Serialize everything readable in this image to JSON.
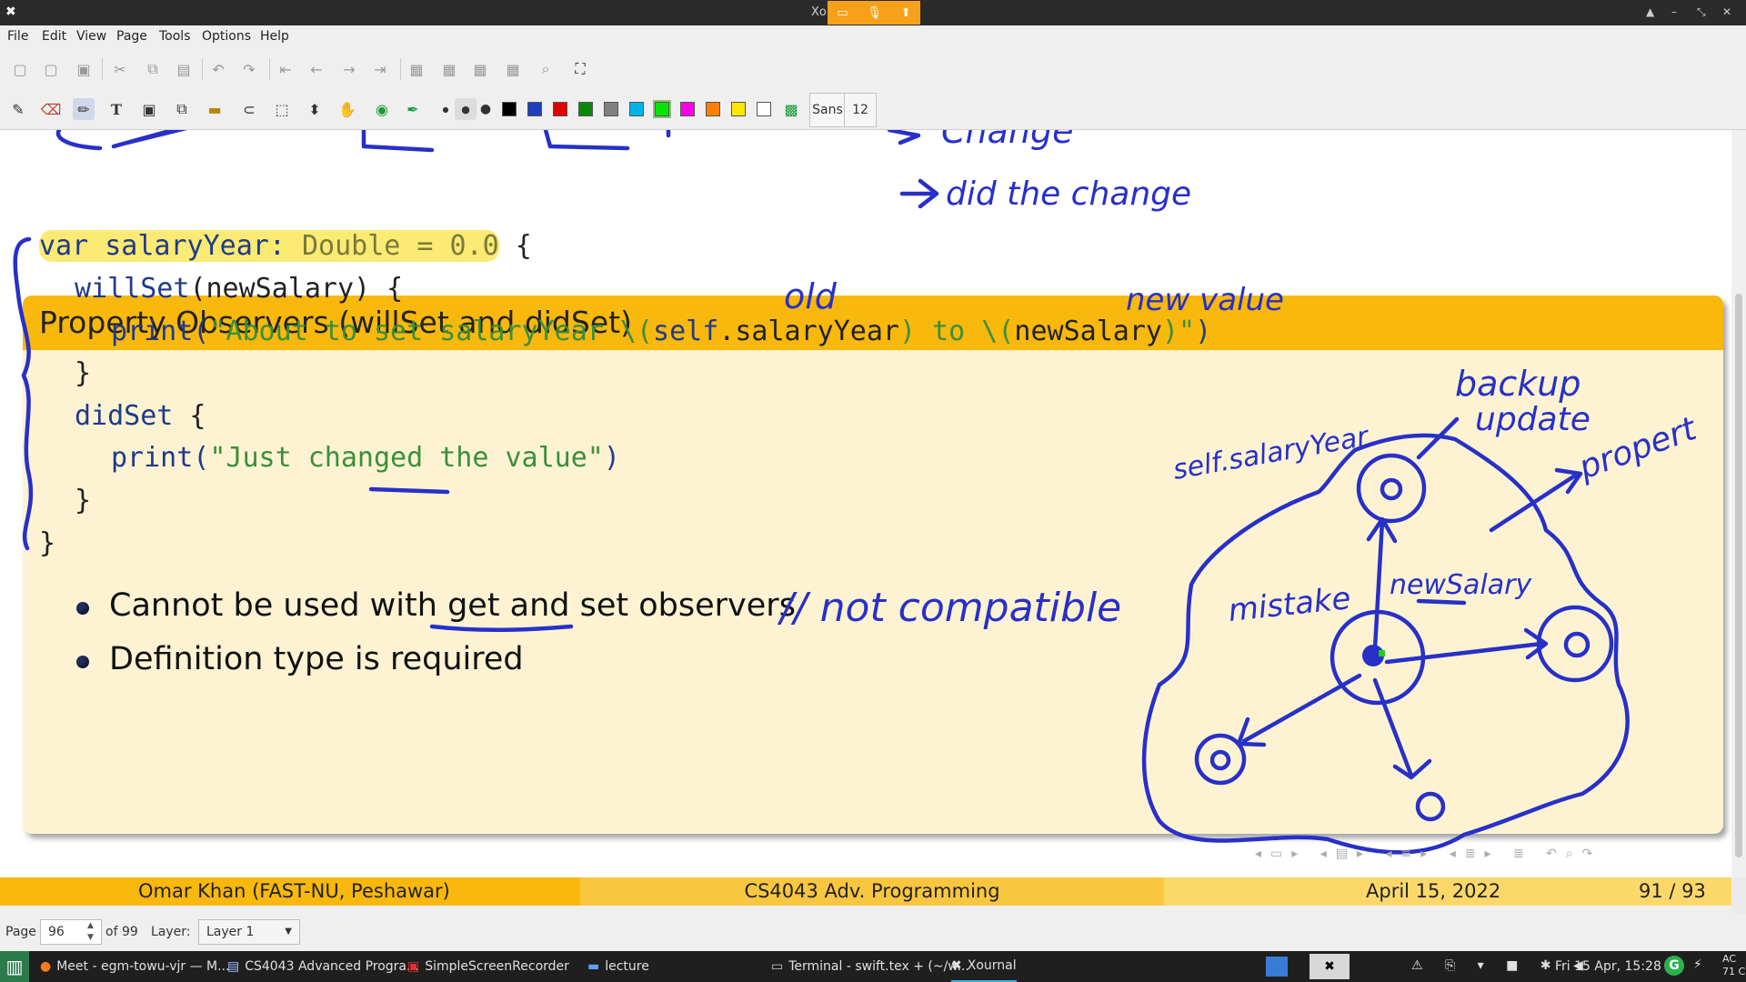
{
  "window": {
    "title": "Xo"
  },
  "menu": [
    "File",
    "Edit",
    "View",
    "Page",
    "Tools",
    "Options",
    "Help"
  ],
  "toolbar": {
    "font_name": "Sans",
    "font_size": "12",
    "colors": [
      "#000000",
      "#1f3fbf",
      "#e00000",
      "#0a8a0a",
      "#808080",
      "#00b4e6",
      "#00e600",
      "#ff00e6",
      "#ff8000",
      "#ffe600",
      "#ffffff"
    ],
    "selected_color": "#00e600"
  },
  "slide": {
    "header_fragments": [
      "Change"
    ],
    "title": "Property Observers (willSet and didSet)",
    "code": {
      "l1_var": "var salaryYear: ",
      "l1_type": "Double = 0.0",
      "l1_tail": " {",
      "l2_kw": "willSet",
      "l2_rest": "(newSalary) {",
      "l3_fn": "print(",
      "l3_str1": "\"About to set salaryYear \\(",
      "l3_self": "self",
      "l3_prop": ".salaryYear",
      "l3_str2": ") to \\(",
      "l3_arg": "newSalary",
      "l3_str3": ")\"",
      "l3_close": ")",
      "l4": "}",
      "l5_kw": "didSet",
      "l5_rest": " {",
      "l6_fn": "print(",
      "l6_str": "\"Just changed the value\"",
      "l6_close": ")",
      "l7": "}",
      "l8": "}"
    },
    "bullets": [
      {
        "before": "Cannot be used with ",
        "underlined": "get and set",
        "after": " observers"
      },
      {
        "text": "Definition type is required"
      }
    ]
  },
  "annotations": {
    "did_change": "did the change",
    "old": "old",
    "new_value": "new value",
    "not_compatible": "// not compatible",
    "backup": "backup",
    "update": "update",
    "self_salary_year": "self.salaryYear",
    "property": "propert",
    "mistake": "mistake",
    "new_salary": "newSalary"
  },
  "footer": {
    "author": "Omar Khan  (FAST-NU, Peshawar)",
    "course": "CS4043 Adv. Programming",
    "date": "April 15, 2022",
    "page": "91 / 93",
    "colors": {
      "left": "#f8b80c",
      "middle": "#f9c640",
      "right": "#fcd86a"
    }
  },
  "pagebar": {
    "page_label": "Page",
    "page_value": "96",
    "of_label": "of 99",
    "layer_label": "Layer:",
    "layer_value": "Layer 1"
  },
  "taskbar": {
    "tasks": [
      {
        "icon": "firefox-icon",
        "label": "Meet - egm-towu-vjr — M..."
      },
      {
        "icon": "document-icon",
        "label": "CS4043 Advanced Progra..."
      },
      {
        "icon": "recorder-icon",
        "label": "SimpleScreenRecorder"
      },
      {
        "icon": "folder-icon",
        "label": "lecture"
      },
      {
        "icon": "terminal-icon",
        "label": "Terminal - swift.tex + (~/w..."
      },
      {
        "icon": "xournal-icon",
        "label": "Xournal"
      }
    ],
    "clock": "Fri 15 Apr, 15:28",
    "ac_label": "AC",
    "ac_sub": "71 C"
  }
}
